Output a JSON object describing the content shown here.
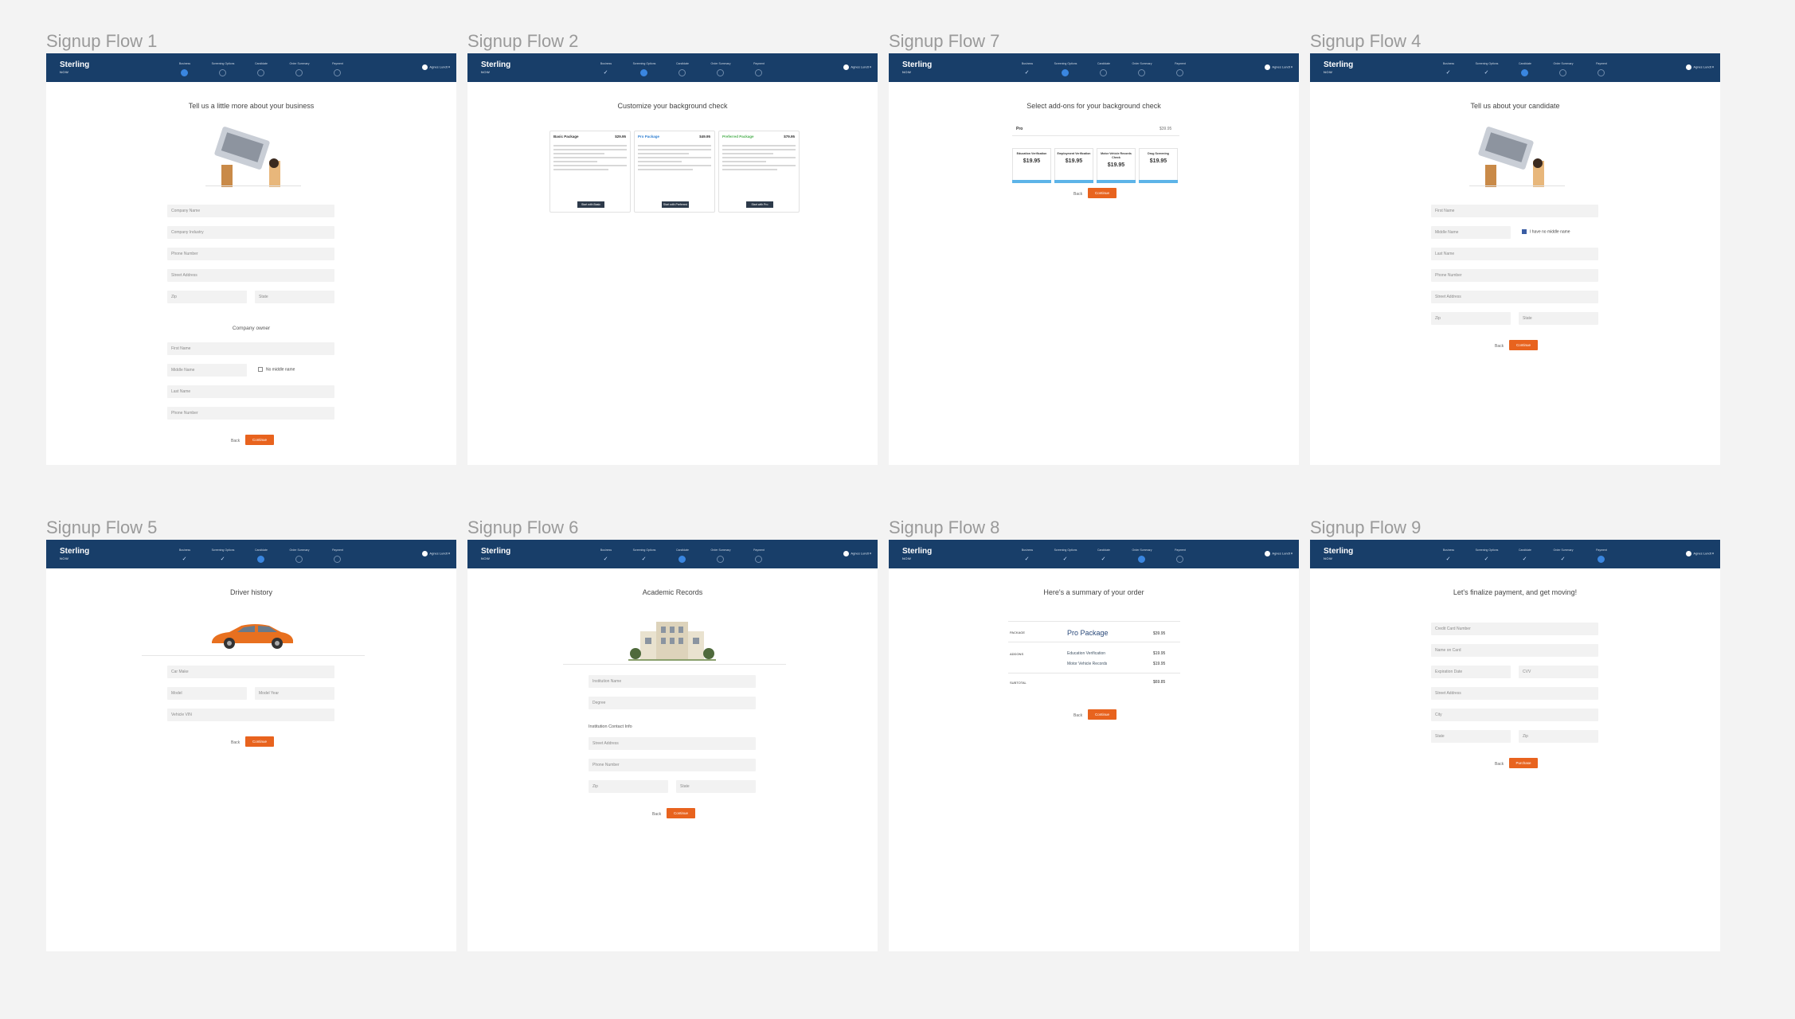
{
  "frames": [
    {
      "title": "Signup Flow 1",
      "heading": "Tell us a little more about your business"
    },
    {
      "title": "Signup Flow 2",
      "heading": "Customize your background check"
    },
    {
      "title": "Signup Flow 7",
      "heading": "Select add-ons for your background check"
    },
    {
      "title": "Signup Flow 4",
      "heading": "Tell us about your candidate"
    },
    {
      "title": "Signup Flow 5",
      "heading": "Driver history"
    },
    {
      "title": "Signup Flow 6",
      "heading": "Academic Records"
    },
    {
      "title": "Signup Flow 8",
      "heading": "Here's a summary of your order"
    },
    {
      "title": "Signup Flow 9",
      "heading": "Let's finalize payment, and get moving!"
    }
  ],
  "nav": {
    "logo": "Sterling",
    "logo_sub": "NOW",
    "steps": [
      "Business",
      "Screening Options",
      "Candidate",
      "Order Summary",
      "Payment"
    ],
    "user": "Agnes Lundt"
  },
  "common": {
    "back": "Back",
    "continue": "Continue",
    "purchase": "Purchase"
  },
  "flow1": {
    "fields": [
      "Company Name",
      "Company Industry",
      "Phone Number",
      "Street Address",
      "Zip",
      "State"
    ],
    "owner_heading": "Company owner",
    "owner_fields": [
      "First Name",
      "Middle Name",
      "Last Name",
      "Phone Number"
    ],
    "no_middle": "No middle name"
  },
  "flow2": {
    "packages": [
      {
        "name": "Basic Package",
        "price": "$29.95",
        "button": "Start with Basic",
        "color": "#333333"
      },
      {
        "name": "Pro Package",
        "price": "$49.95",
        "button": "Start with Preferred",
        "color": "#2f7fd0"
      },
      {
        "name": "Preferred Package",
        "price": "$79.95",
        "button": "Start with Pro",
        "color": "#4caf50"
      }
    ]
  },
  "flow7": {
    "pkg_label": "Pro",
    "pkg_price": "$39.95",
    "addons": [
      {
        "name": "Education Verification",
        "price": "$19.95"
      },
      {
        "name": "Employment Verification",
        "price": "$19.95"
      },
      {
        "name": "Motor Vehicle Records Check",
        "price": "$19.95"
      },
      {
        "name": "Drug Screening",
        "price": "$19.95"
      }
    ]
  },
  "flow4": {
    "fields": [
      "First Name",
      "Middle Name",
      "Last Name",
      "Phone Number",
      "Street Address",
      "Zip",
      "State"
    ],
    "no_middle": "I have no middle name"
  },
  "flow5": {
    "fields": [
      "Car Make",
      "Model",
      "Model Year",
      "Vehicle VIN"
    ]
  },
  "flow6": {
    "fields": [
      "Institution Name",
      "Degree"
    ],
    "contact_heading": "Institution Contact Info",
    "contact_fields": [
      "Street Address",
      "Phone Number",
      "Zip",
      "State"
    ]
  },
  "flow8": {
    "package_label": "PACKAGE",
    "package_name": "Pro Package",
    "package_price": "$39.95",
    "addons_label": "ADDONS",
    "addons": [
      {
        "name": "Education Verification",
        "price": "$19.95"
      },
      {
        "name": "Motor Vehicle Records",
        "price": "$19.95"
      }
    ],
    "subtotal_label": "SUBTOTAL",
    "subtotal": "$69.85"
  },
  "flow9": {
    "fields": [
      "Credit Card Number",
      "Name on Card",
      "Expiration Date",
      "CVV",
      "Street Address",
      "City",
      "State",
      "Zip"
    ]
  },
  "colors": {
    "nav": "#183e69",
    "accent": "#e8631e",
    "active_step": "#3a86e0"
  }
}
